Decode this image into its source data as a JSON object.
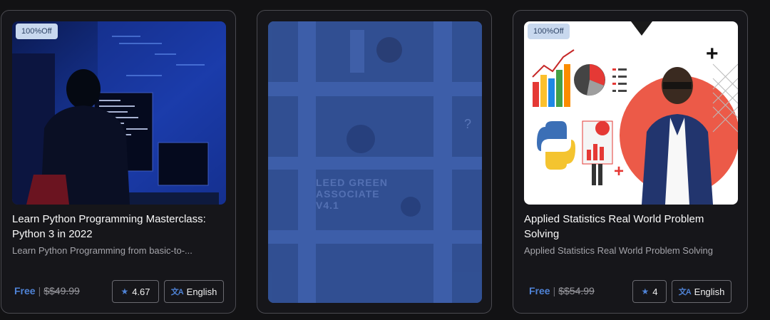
{
  "cards": [
    {
      "badge": "100%Off",
      "title": "Learn Python Programming Masterclass: Python 3 in 2022",
      "subtitle": "Learn Python Programming from basic-to-...",
      "price_free": "Free",
      "price_sep": "|",
      "price_old": "$$49.99",
      "rating": "4.67",
      "language": "English",
      "icons": [
        "star-icon",
        "translate-icon"
      ]
    },
    {
      "placeholder_text": "LEED GREEN ASSOCIATE V4.1"
    },
    {
      "badge": "100%Off",
      "title": "Applied Statistics Real World Problem Solving",
      "subtitle": "Applied Statistics Real World Problem Solving",
      "price_free": "Free",
      "price_sep": "|",
      "price_old": "$$54.99",
      "rating": "4",
      "language": "English",
      "icons": [
        "star-icon",
        "translate-icon"
      ]
    }
  ],
  "colors": {
    "background": "#121214",
    "card": "#16161a",
    "accent": "#4f83d6",
    "badge_bg": "#c8d8ee"
  }
}
